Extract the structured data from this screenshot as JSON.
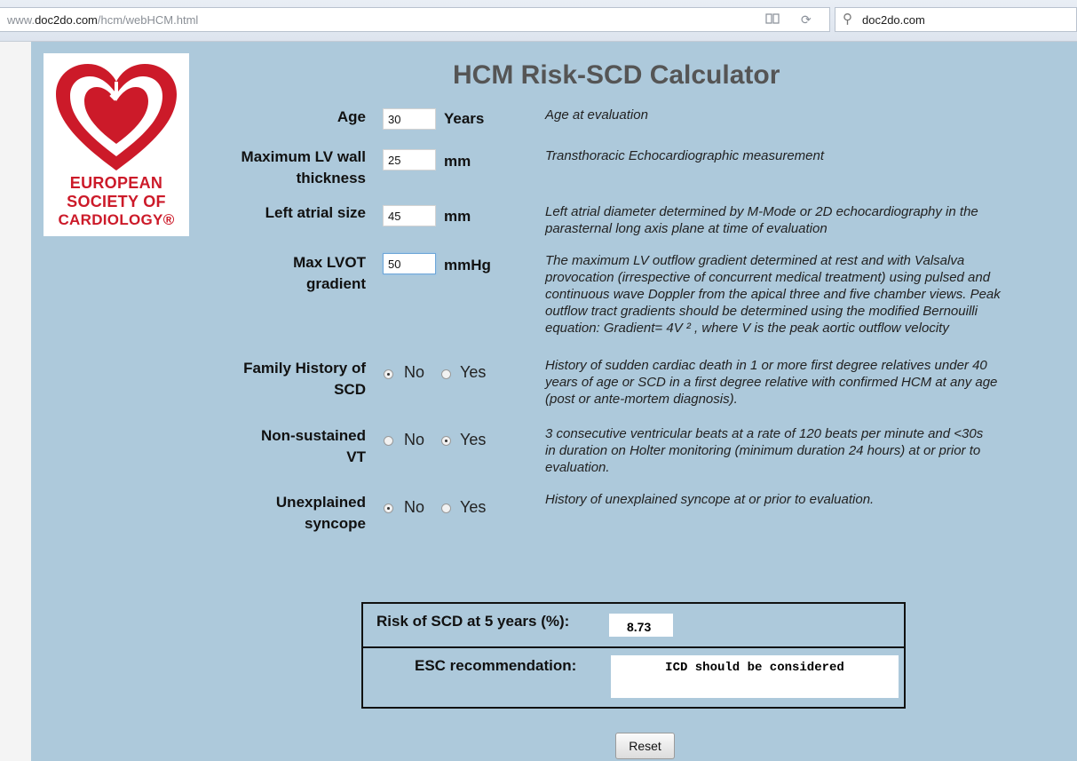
{
  "browser": {
    "url_prefix": "www.",
    "url_domain": "doc2do.com",
    "url_path": "/hcm/webHCM.html",
    "search_text": "doc2do.com"
  },
  "logo": {
    "line1": "EUROPEAN",
    "line2": "SOCIETY OF",
    "line3": "CARDIOLOGY®"
  },
  "title": "HCM Risk-SCD Calculator",
  "fields": {
    "age": {
      "label": "Age",
      "value": "30",
      "unit": "Years",
      "desc": "Age at evaluation"
    },
    "lvwall": {
      "label_l1": "Maximum LV wall",
      "label_l2": "thickness",
      "value": "25",
      "unit": "mm",
      "desc": "Transthoracic Echocardiographic measurement"
    },
    "la": {
      "label": "Left atrial size",
      "value": "45",
      "unit": "mm",
      "desc_l1": "Left atrial diameter determined by M-Mode or 2D echocardiography in the",
      "desc_l2": "parasternal long axis plane at time of evaluation"
    },
    "lvot": {
      "label_l1": "Max LVOT",
      "label_l2": "gradient",
      "value": "50",
      "unit": "mmHg",
      "desc_l1": "The maximum LV outflow gradient determined at rest and with Valsalva",
      "desc_l2": "provocation (irrespective of concurrent medical treatment) using pulsed and",
      "desc_l3": "continuous wave Doppler from the apical three and five chamber views. Peak",
      "desc_l4": "outflow tract gradients should be determined using the modified Bernouilli",
      "desc_l5": "equation: Gradient= 4V ² , where V is the peak aortic outflow velocity"
    }
  },
  "radios": {
    "fhscd": {
      "label_l1": "Family History of",
      "label_l2": "SCD",
      "no": "No",
      "yes": "Yes",
      "selected": "No",
      "desc_l1": "History of sudden cardiac death in 1 or more first degree relatives under 40",
      "desc_l2": "years of age or SCD in a first degree relative with confirmed HCM at any age",
      "desc_l3": "(post or ante-mortem diagnosis)."
    },
    "nsvt": {
      "label_l1": "Non-sustained",
      "label_l2": "VT",
      "no": "No",
      "yes": "Yes",
      "selected": "Yes",
      "desc_l1": "3 consecutive ventricular beats at a rate of 120 beats per minute and <30s",
      "desc_l2": "in duration on Holter monitoring (minimum duration 24 hours) at or prior to",
      "desc_l3": "evaluation."
    },
    "syncope": {
      "label_l1": "Unexplained",
      "label_l2": "syncope",
      "no": "No",
      "yes": "Yes",
      "selected": "No",
      "desc": "History of unexplained syncope at or prior to evaluation."
    }
  },
  "result": {
    "risk_label": "Risk of SCD at 5 years (%):",
    "risk_value": "8.73",
    "rec_label": "ESC recommendation:",
    "rec_value": "ICD should be considered"
  },
  "reset_label": "Reset"
}
